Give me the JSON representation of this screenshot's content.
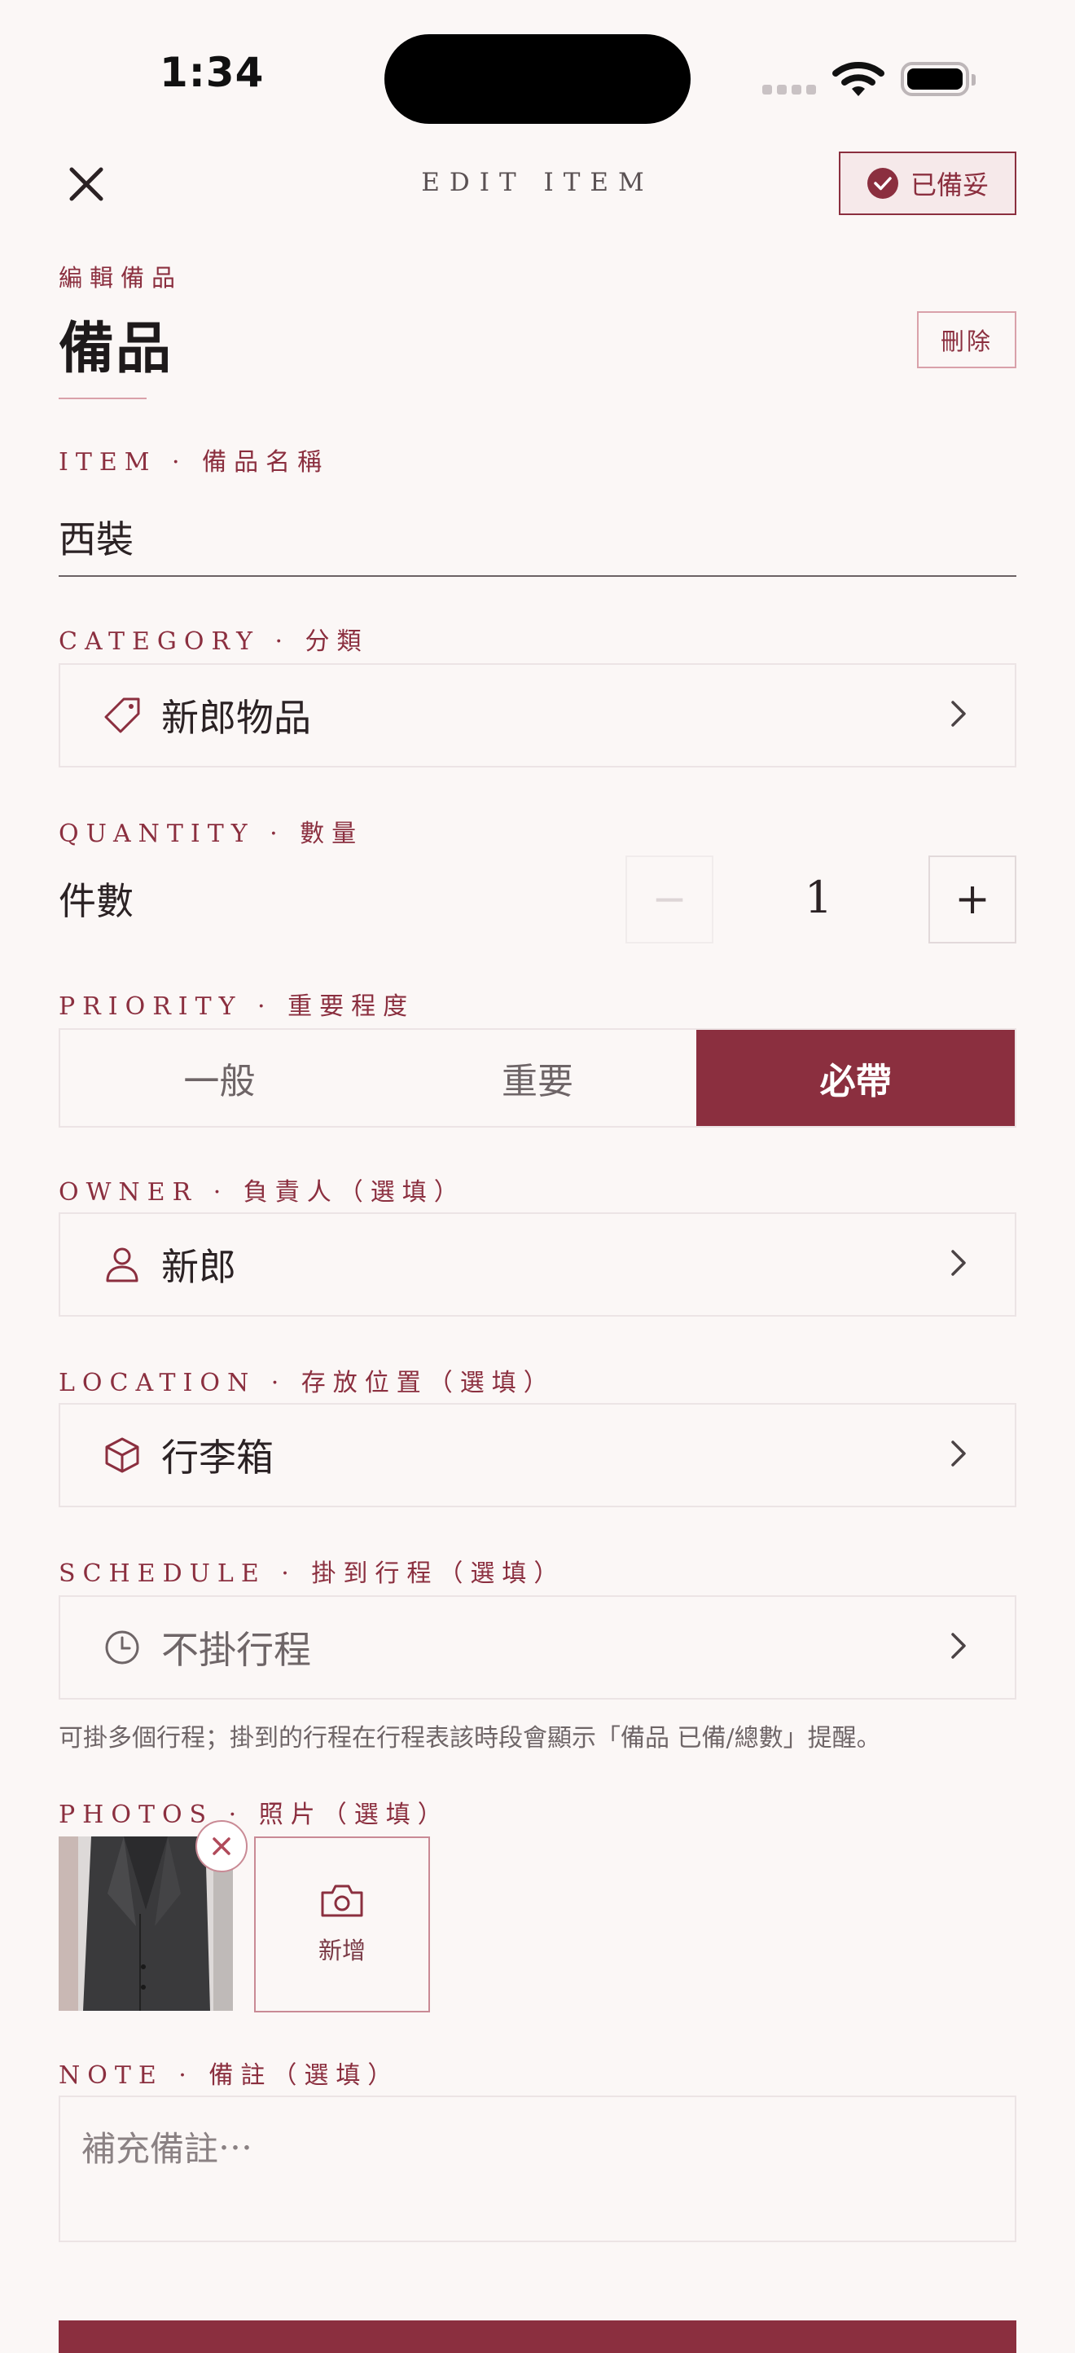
{
  "status_bar": {
    "time": "1:34"
  },
  "header": {
    "title": "EDIT ITEM",
    "ready_label": "已備妥"
  },
  "page": {
    "eyebrow": "編輯備品",
    "title": "備品",
    "delete_label": "刪除"
  },
  "item": {
    "label": "ITEM · 備品名稱",
    "value": "西裝"
  },
  "category": {
    "label": "CATEGORY · 分類",
    "value": "新郎物品",
    "icon": "tag-icon"
  },
  "quantity": {
    "label": "QUANTITY · 數量",
    "row_label": "件數",
    "value": "1",
    "minus": "−",
    "plus": "+"
  },
  "priority": {
    "label": "PRIORITY · 重要程度",
    "options": [
      "一般",
      "重要",
      "必帶"
    ],
    "selected": "必帶"
  },
  "owner": {
    "label": "OWNER · 負責人（選填）",
    "value": "新郎",
    "icon": "person-icon"
  },
  "location": {
    "label": "LOCATION · 存放位置（選填）",
    "value": "行李箱",
    "icon": "box-icon"
  },
  "schedule": {
    "label": "SCHEDULE · 掛到行程（選填）",
    "value": "不掛行程",
    "icon": "clock-icon",
    "hint": "可掛多個行程；掛到的行程在行程表該時段會顯示「備品 已備/總數」提醒。"
  },
  "photos": {
    "label": "PHOTOS · 照片（選填）",
    "add_label": "新增",
    "count": 1
  },
  "note": {
    "label": "NOTE · 備註（選填）",
    "placeholder": "補充備註⋯"
  },
  "colors": {
    "accent": "#8b2f3f",
    "background": "#fbf7f6",
    "border": "#ece4e5"
  }
}
